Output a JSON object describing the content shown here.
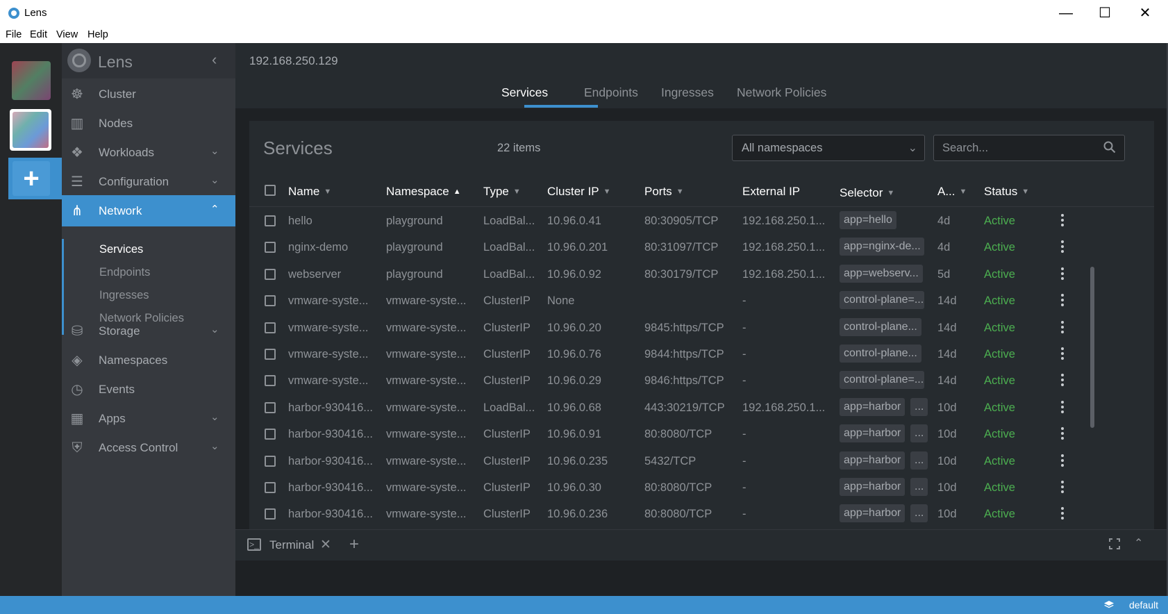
{
  "window": {
    "title": "Lens",
    "min_glyph": "—",
    "max_glyph": "☐",
    "close_glyph": "✕"
  },
  "menu": [
    "File",
    "Edit",
    "View",
    "Help"
  ],
  "rail": {
    "add_label": "+"
  },
  "sidebar": {
    "title": "Lens",
    "collapse_glyph": "‹",
    "items": [
      {
        "label": "Cluster",
        "icon": "helm-wheel-icon",
        "glyph": "☸",
        "has_chevron": false
      },
      {
        "label": "Nodes",
        "icon": "server-rack-icon",
        "glyph": "▥",
        "has_chevron": false
      },
      {
        "label": "Workloads",
        "icon": "cubes-icon",
        "glyph": "❖",
        "has_chevron": true
      },
      {
        "label": "Configuration",
        "icon": "list-icon",
        "glyph": "☰",
        "has_chevron": true
      },
      {
        "label": "Network",
        "icon": "network-icon",
        "glyph": "⋔",
        "has_chevron": true,
        "active": true
      },
      {
        "label": "Storage",
        "icon": "database-icon",
        "glyph": "⛁",
        "has_chevron": true
      },
      {
        "label": "Namespaces",
        "icon": "layers-icon",
        "glyph": "◈",
        "has_chevron": false
      },
      {
        "label": "Events",
        "icon": "clock-icon",
        "glyph": "◷",
        "has_chevron": false
      },
      {
        "label": "Apps",
        "icon": "grid-apps-icon",
        "glyph": "▦",
        "has_chevron": true
      },
      {
        "label": "Access Control",
        "icon": "shield-icon",
        "glyph": "⛨",
        "has_chevron": true
      }
    ],
    "network_sub": [
      "Services",
      "Endpoints",
      "Ingresses",
      "Network Policies"
    ],
    "chevron_down": "⌄",
    "chevron_up": "⌃"
  },
  "main": {
    "cluster_ip": "192.168.250.129",
    "tabs": [
      "Services",
      "Endpoints",
      "Ingresses",
      "Network Policies"
    ],
    "active_tab": "Services"
  },
  "panel": {
    "title": "Services",
    "count": "22 items",
    "namespace_select": "All namespaces",
    "search_placeholder": "Search...",
    "columns": [
      "Name",
      "Namespace",
      "Type",
      "Cluster IP",
      "Ports",
      "External IP",
      "Selector",
      "A...",
      "Status"
    ],
    "sort_column": "Namespace",
    "rows": [
      {
        "name": "hello",
        "namespace": "playground",
        "type": "LoadBal...",
        "cluster_ip": "10.96.0.41",
        "ports": "80:30905/TCP",
        "external_ip": "192.168.250.1...",
        "selector": [
          "app=hello"
        ],
        "age": "4d",
        "status": "Active"
      },
      {
        "name": "nginx-demo",
        "namespace": "playground",
        "type": "LoadBal...",
        "cluster_ip": "10.96.0.201",
        "ports": "80:31097/TCP",
        "external_ip": "192.168.250.1...",
        "selector": [
          "app=nginx-de..."
        ],
        "age": "4d",
        "status": "Active"
      },
      {
        "name": "webserver",
        "namespace": "playground",
        "type": "LoadBal...",
        "cluster_ip": "10.96.0.92",
        "ports": "80:30179/TCP",
        "external_ip": "192.168.250.1...",
        "selector": [
          "app=webserv..."
        ],
        "age": "5d",
        "status": "Active"
      },
      {
        "name": "vmware-syste...",
        "namespace": "vmware-syste...",
        "type": "ClusterIP",
        "cluster_ip": "None",
        "ports": "",
        "external_ip": "-",
        "selector": [
          "control-plane=..."
        ],
        "age": "14d",
        "status": "Active"
      },
      {
        "name": "vmware-syste...",
        "namespace": "vmware-syste...",
        "type": "ClusterIP",
        "cluster_ip": "10.96.0.20",
        "ports": "9845:https/TCP",
        "external_ip": "-",
        "selector": [
          "control-plane..."
        ],
        "age": "14d",
        "status": "Active"
      },
      {
        "name": "vmware-syste...",
        "namespace": "vmware-syste...",
        "type": "ClusterIP",
        "cluster_ip": "10.96.0.76",
        "ports": "9844:https/TCP",
        "external_ip": "-",
        "selector": [
          "control-plane..."
        ],
        "age": "14d",
        "status": "Active"
      },
      {
        "name": "vmware-syste...",
        "namespace": "vmware-syste...",
        "type": "ClusterIP",
        "cluster_ip": "10.96.0.29",
        "ports": "9846:https/TCP",
        "external_ip": "-",
        "selector": [
          "control-plane=..."
        ],
        "age": "14d",
        "status": "Active"
      },
      {
        "name": "harbor-930416...",
        "namespace": "vmware-syste...",
        "type": "LoadBal...",
        "cluster_ip": "10.96.0.68",
        "ports": "443:30219/TCP",
        "external_ip": "192.168.250.1...",
        "selector": [
          "app=harbor",
          "..."
        ],
        "age": "10d",
        "status": "Active"
      },
      {
        "name": "harbor-930416...",
        "namespace": "vmware-syste...",
        "type": "ClusterIP",
        "cluster_ip": "10.96.0.91",
        "ports": "80:8080/TCP",
        "external_ip": "-",
        "selector": [
          "app=harbor",
          "..."
        ],
        "age": "10d",
        "status": "Active"
      },
      {
        "name": "harbor-930416...",
        "namespace": "vmware-syste...",
        "type": "ClusterIP",
        "cluster_ip": "10.96.0.235",
        "ports": "5432/TCP",
        "external_ip": "-",
        "selector": [
          "app=harbor",
          "..."
        ],
        "age": "10d",
        "status": "Active"
      },
      {
        "name": "harbor-930416...",
        "namespace": "vmware-syste...",
        "type": "ClusterIP",
        "cluster_ip": "10.96.0.30",
        "ports": "80:8080/TCP",
        "external_ip": "-",
        "selector": [
          "app=harbor",
          "..."
        ],
        "age": "10d",
        "status": "Active"
      },
      {
        "name": "harbor-930416...",
        "namespace": "vmware-syste...",
        "type": "ClusterIP",
        "cluster_ip": "10.96.0.236",
        "ports": "80:8080/TCP",
        "external_ip": "-",
        "selector": [
          "app=harbor",
          "..."
        ],
        "age": "10d",
        "status": "Active"
      }
    ]
  },
  "dock": {
    "tab_label": "Terminal",
    "term_glyph": ">_",
    "close_glyph": "✕",
    "add_glyph": "+",
    "up_glyph": "⌃"
  },
  "statusbar": {
    "context": "default"
  },
  "colors": {
    "accent": "#3d90ce",
    "active_status": "#4caf50",
    "sidebar_bg": "#36393e",
    "main_bg": "#1e2124",
    "panel_bg": "#262b2f"
  }
}
